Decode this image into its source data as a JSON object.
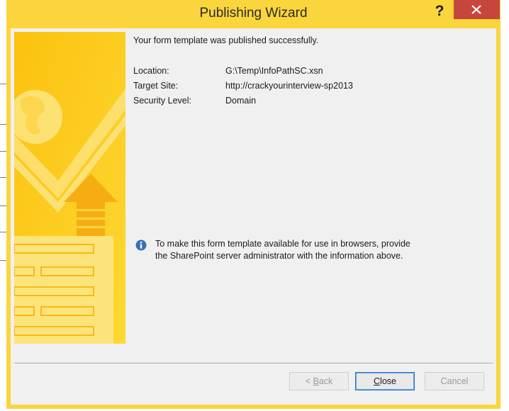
{
  "window": {
    "title": "Publishing Wizard",
    "help_glyph": "?",
    "close_icon": "close-icon"
  },
  "content": {
    "success_message": "Your form template was published successfully.",
    "details": [
      {
        "label": "Location:",
        "value": "G:\\Temp\\InfoPathSC.xsn"
      },
      {
        "label": "Target Site:",
        "value": "http://crackyourinterview-sp2013"
      },
      {
        "label": "Security Level:",
        "value": "Domain"
      }
    ],
    "note_icon": "info-icon",
    "note_line1": "To make this form template available for use in browsers, provide",
    "note_line2": "the SharePoint server administrator with the information above."
  },
  "buttons": {
    "back": {
      "prefix": "< ",
      "accel": "B",
      "rest": "ack"
    },
    "close": {
      "accel": "C",
      "rest": "lose"
    },
    "cancel": {
      "label": "Cancel"
    }
  },
  "colors": {
    "frame": "#fbd53c",
    "close_button": "#c7463c",
    "client_bg": "#f0f0f0",
    "info_icon": "#3b6fb5"
  }
}
